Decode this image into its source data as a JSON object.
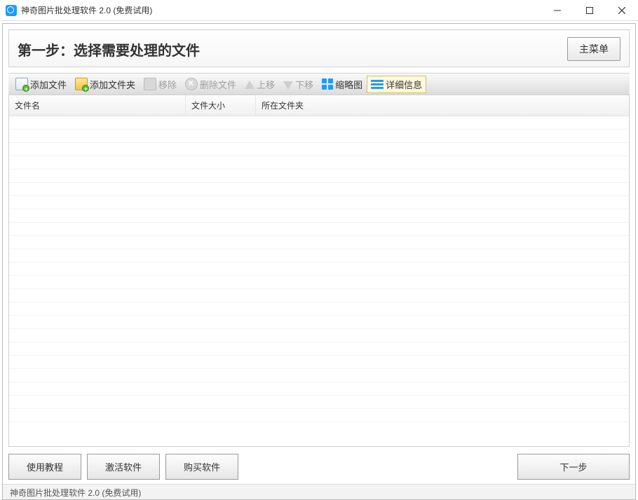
{
  "titlebar": {
    "title": "神奇图片批处理软件 2.0 (免费试用)"
  },
  "step": {
    "title": "第一步：选择需要处理的文件",
    "main_menu": "主菜单"
  },
  "toolbar": {
    "add_file": "添加文件",
    "add_folder": "添加文件夹",
    "remove": "移除",
    "delete_file": "删除文件",
    "move_up": "上移",
    "move_down": "下移",
    "thumbnail": "缩略图",
    "detail": "详细信息"
  },
  "table": {
    "columns": {
      "name": "文件名",
      "size": "文件大小",
      "folder": "所在文件夹"
    },
    "rows": []
  },
  "bottom": {
    "tutorial": "使用教程",
    "activate": "激活软件",
    "purchase": "购买软件",
    "next": "下一步"
  },
  "statusbar": {
    "text": "神奇图片批处理软件 2.0 (免费试用)"
  }
}
